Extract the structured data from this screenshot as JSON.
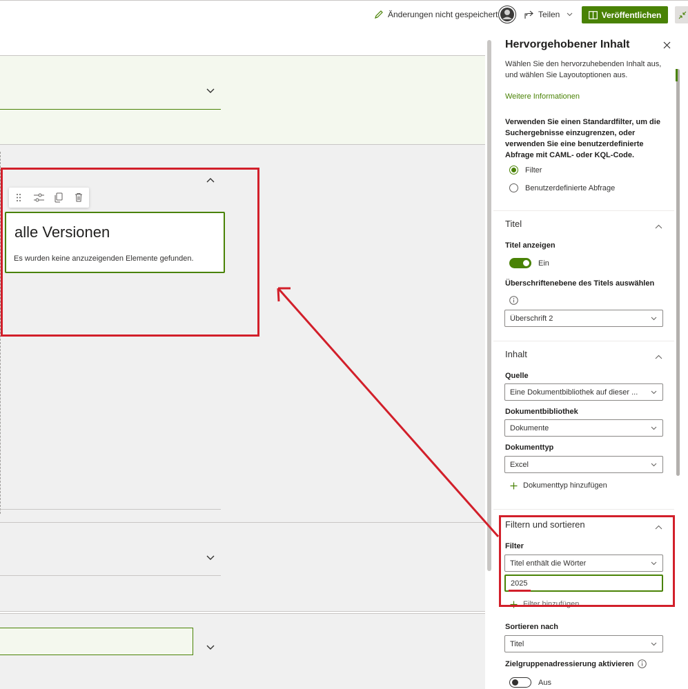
{
  "topbar": {
    "unsaved_label": "Änderungen nicht gespeichert",
    "share_label": "Teilen",
    "publish_label": "Veröffentlichen"
  },
  "canvas": {
    "webpart_title": "alle Versionen",
    "webpart_empty_text": "Es wurden keine anzuzeigenden Elemente gefunden."
  },
  "panel": {
    "title": "Hervorgehobener Inhalt",
    "intro": "Wählen Sie den hervorzuhebenden Inhalt aus, und wählen Sie Layoutoptionen aus.",
    "more_info_link": "Weitere Informationen",
    "filter_intro": "Verwenden Sie einen Standardfilter, um die Suchergebnisse einzugrenzen, oder verwenden Sie eine benutzerdefinierte Abfrage mit CAML- oder KQL-Code.",
    "radio_filter": "Filter",
    "radio_custom": "Benutzerdefinierte Abfrage",
    "section_title": {
      "title": "Titel",
      "show_title_label": "Titel anzeigen",
      "show_title_state": "Ein",
      "heading_level_label": "Überschriftenebene des Titels auswählen",
      "heading_level_value": "Überschrift 2"
    },
    "section_content": {
      "title": "Inhalt",
      "source_label": "Quelle",
      "source_value": "Eine Dokumentbibliothek auf dieser ...",
      "library_label": "Dokumentbibliothek",
      "library_value": "Dokumente",
      "doctype_label": "Dokumenttyp",
      "doctype_value": "Excel",
      "add_doctype_label": "Dokumenttyp hinzufügen"
    },
    "section_filter": {
      "title": "Filtern und sortieren",
      "filter_label": "Filter",
      "filter_value": "Titel enthält die Wörter",
      "filter_input_value": "2025",
      "add_filter_label": "Filter hinzufügen",
      "sort_label": "Sortieren nach",
      "sort_value": "Titel",
      "audience_label": "Zielgruppenadressierung aktivieren",
      "audience_state": "Aus"
    }
  },
  "colors": {
    "accent": "#498205",
    "highlight_red": "#d21f2a",
    "section_bg_light_green": "#f4f8ee",
    "section_bg_grey": "#f0f0f0"
  }
}
